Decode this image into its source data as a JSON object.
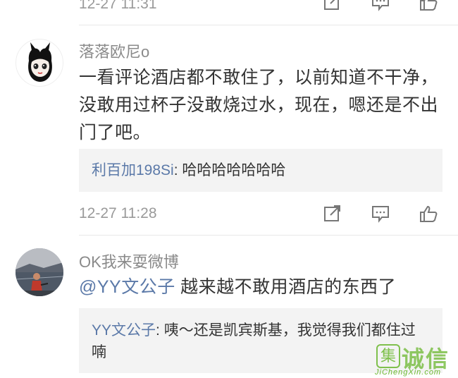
{
  "colors": {
    "link": "#5b79a8",
    "meta": "#9a9a9a",
    "reply_bg": "#f3f3f3",
    "watermark": "#6bb82f"
  },
  "top_comment": {
    "time": "12-27 11:31",
    "icons": [
      "share-icon",
      "comment-icon",
      "like-icon"
    ]
  },
  "comments": [
    {
      "username": "落落欧尼o",
      "text": "一看评论酒店都不敢住了，以前知道不干净，没敢用过杯子没敢烧过水，现在，嗯还是不出门了吧。",
      "reply": {
        "user": "利百加198Si",
        "sep": ":",
        "text": " 哈哈哈哈哈哈哈"
      },
      "time": "12-27 11:28",
      "icons": [
        "share-icon",
        "comment-icon",
        "like-icon"
      ]
    },
    {
      "username": "OK我来耍微博",
      "mention": "@YY文公子",
      "text": " 越来越不敢用酒店的东西了",
      "reply": {
        "user": "YY文公子",
        "sep": ":",
        "text": " 咦～还是凯宾斯基，我觉得我们都住过喃"
      }
    }
  ],
  "watermark": {
    "logo_glyph": "集",
    "text": "诚信",
    "url": "JiChengXin.com"
  }
}
